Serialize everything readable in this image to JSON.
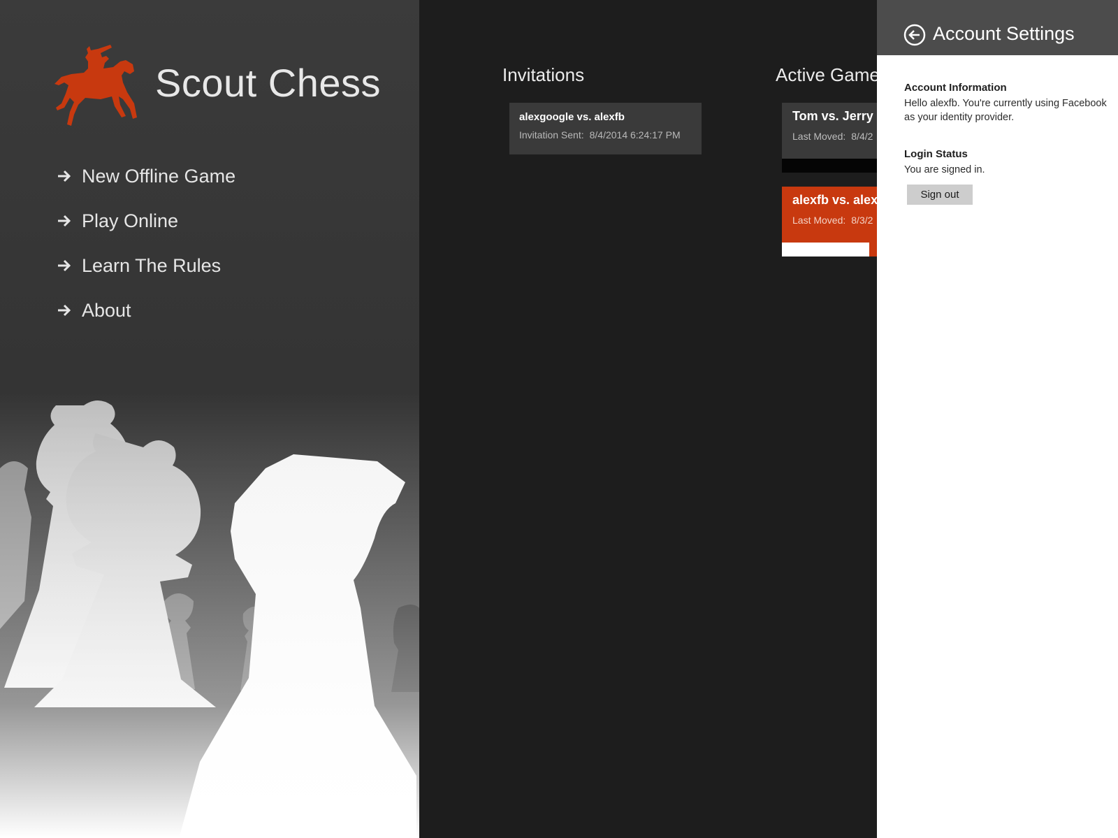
{
  "app": {
    "title": "Scout Chess",
    "accent_color": "#c8390f",
    "logo_icon": "horse-rider-logo"
  },
  "nav": {
    "items": [
      {
        "label": "New Offline Game",
        "icon": "arrow-right-icon"
      },
      {
        "label": "Play Online",
        "icon": "arrow-right-icon"
      },
      {
        "label": "Learn The Rules",
        "icon": "arrow-right-icon"
      },
      {
        "label": "About",
        "icon": "arrow-right-icon"
      }
    ]
  },
  "invitations": {
    "title": "Invitations",
    "cards": [
      {
        "title": "alexgoogle vs. alexfb",
        "label": "Invitation Sent:",
        "value": "8/4/2014 6:24:17 PM"
      }
    ]
  },
  "active_games": {
    "title": "Active Game",
    "cards": [
      {
        "title": "Tom vs. Jerry",
        "label": "Last Moved:",
        "value": "8/4/2",
        "style": "dark"
      },
      {
        "title": "alexfb vs. alex",
        "label": "Last Moved:",
        "value": "8/3/2",
        "style": "orange"
      }
    ]
  },
  "settings": {
    "title": "Account Settings",
    "back_icon": "back-arrow-circle-icon",
    "account_info": {
      "heading": "Account Information",
      "text": "Hello alexfb. You're currently using Facebook as your identity provider."
    },
    "login_status": {
      "heading": "Login Status",
      "text": "You are signed in.",
      "button_label": "Sign out"
    }
  }
}
